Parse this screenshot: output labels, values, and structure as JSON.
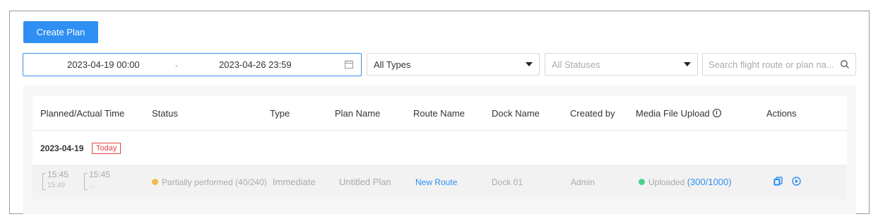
{
  "toolbar": {
    "create_label": "Create Plan"
  },
  "filters": {
    "date_start": "2023-04-19 00:00",
    "date_separator": "-",
    "date_end": "2023-04-26 23:59",
    "type_value": "All Types",
    "status_placeholder": "All Statuses",
    "search_placeholder": "Search flight route or plan na..."
  },
  "table": {
    "headers": {
      "time": "Planned/Actual Time",
      "status": "Status",
      "type": "Type",
      "plan": "Plan Name",
      "route": "Route Name",
      "dock": "Dock Name",
      "creator": "Created by",
      "media": "Media File Upload",
      "actions": "Actions"
    },
    "group": {
      "date": "2023-04-19",
      "badge": "Today"
    },
    "rows": [
      {
        "planned_time": "15:45",
        "planned_end": "15:49",
        "actual_time": "15:45",
        "actual_end": "...",
        "status_text": "Partially performed (40/240)",
        "status_color": "#f5b94a",
        "type": "Immediate",
        "plan_name": "Untitled Plan",
        "route_name": "New Route",
        "dock_name": "Dock 01",
        "creator": "Admin",
        "upload_text": "Uploaded",
        "upload_count": "(300/1000)",
        "upload_color": "#4cd18a",
        "action_icons": [
          "copy-icon",
          "play-icon"
        ]
      }
    ]
  },
  "colors": {
    "accent": "#2f8ff2",
    "today": "#e04545"
  }
}
